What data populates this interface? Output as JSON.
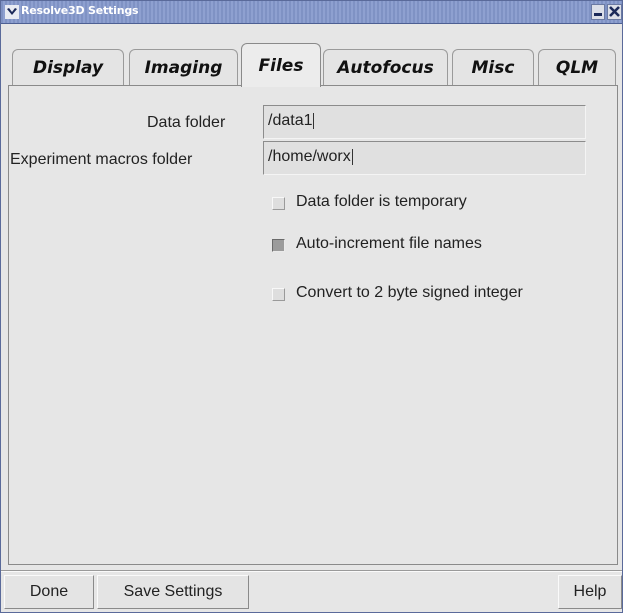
{
  "window": {
    "title": "Resolve3D Settings",
    "menu_icon": "chevron-down-icon",
    "minimize_icon": "minimize-icon",
    "close_icon": "close-icon",
    "titlebar_color": "#8a9cce"
  },
  "tabs": [
    {
      "label": "Display",
      "active": false
    },
    {
      "label": "Imaging",
      "active": false
    },
    {
      "label": "Files",
      "active": true
    },
    {
      "label": "Autofocus",
      "active": false
    },
    {
      "label": "Misc",
      "active": false
    },
    {
      "label": "QLM",
      "active": false
    }
  ],
  "files": {
    "data_folder_label": "Data folder",
    "data_folder_value": "/data1",
    "macros_folder_label": "Experiment macros folder",
    "macros_folder_value": "/home/worx",
    "options": [
      {
        "label": "Data folder is temporary",
        "checked": false
      },
      {
        "label": "Auto-increment file names",
        "checked": true
      },
      {
        "label": "Convert to 2 byte signed integer",
        "checked": false
      }
    ]
  },
  "footer": {
    "done_label": "Done",
    "save_label": "Save Settings",
    "help_label": "Help"
  }
}
